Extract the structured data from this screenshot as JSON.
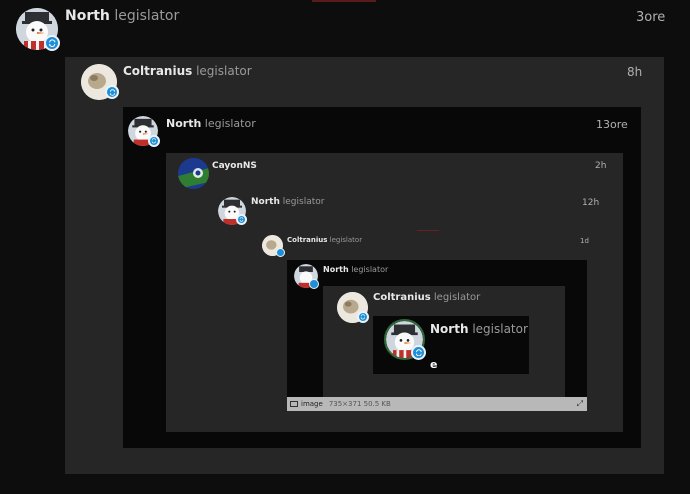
{
  "posts": [
    {
      "name": "North",
      "role": "legislator",
      "time": "3ore"
    },
    {
      "name": "Coltranius",
      "role": "legislator",
      "time": "8h"
    },
    {
      "name": "North",
      "role": "legislator",
      "time": "13ore"
    },
    {
      "name": "CayonNS",
      "role": "",
      "time": "2h"
    },
    {
      "name": "North",
      "role": "legislator",
      "time": "12h"
    },
    {
      "name": "Coltranius",
      "role": "legislator",
      "time": "1d"
    },
    {
      "name": "North",
      "role": "legislator",
      "time": ""
    },
    {
      "name": "Coltranius",
      "role": "legislator",
      "time": ""
    },
    {
      "name": "North",
      "role": "legislator",
      "time": ""
    }
  ],
  "innermost_text": "e",
  "image_bar": {
    "label": "image",
    "meta": "735×371 50.5 KB"
  },
  "icons": {
    "badge": "sync-badge-icon",
    "image": "image-icon",
    "expand": "expand-icon"
  },
  "colors": {
    "background": "#0d0d0d",
    "panel_gray": "#262626",
    "panel_black": "#080808",
    "badge_blue": "#1f8fd6"
  }
}
